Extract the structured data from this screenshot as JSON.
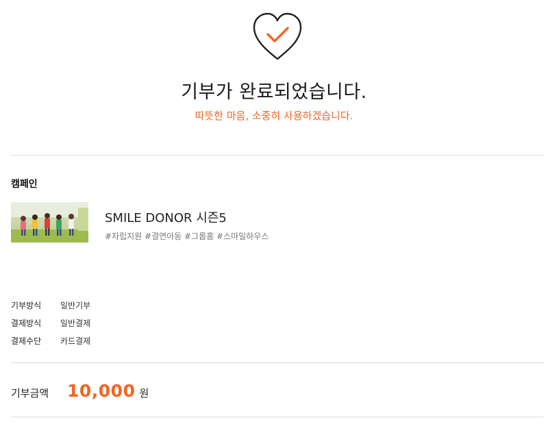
{
  "header": {
    "icon": "heart-check-icon",
    "title": "기부가 완료되었습니다.",
    "subtitle": "따뜻한 마음, 소중히 사용하겠습니다."
  },
  "campaign": {
    "section_title": "캠페인",
    "thumbnail": "children-running-photo",
    "name": "SMILE DONOR 시즌5",
    "tags": "#자립지원 #결연아동 #그룹홈 #스마일하우스"
  },
  "details": [
    {
      "key": "기부방식",
      "value": "일반기부"
    },
    {
      "key": "결제방식",
      "value": "일반결제"
    },
    {
      "key": "결제수단",
      "value": "카드결제"
    }
  ],
  "amount": {
    "label": "기부금액",
    "value": "10,000",
    "unit": "원"
  },
  "colors": {
    "accent": "#f26522",
    "divider": "#dcdcdc",
    "text": "#222222"
  }
}
